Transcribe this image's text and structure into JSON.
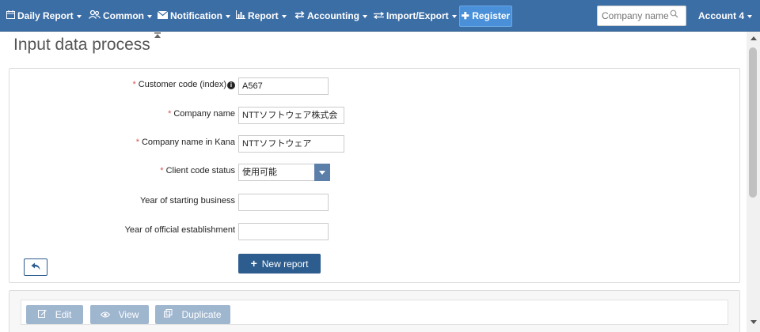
{
  "nav": {
    "daily_report": "Daily Report",
    "common": "Common",
    "notification": "Notification",
    "report": "Report",
    "accounting": "Accounting",
    "import_export": "Import/Export",
    "register": "Register",
    "search_placeholder": "Company name",
    "account": "Account 4"
  },
  "page": {
    "title": "Input data process"
  },
  "form": {
    "customer_code_label": "Customer code (index)",
    "customer_code_value": "A567",
    "company_name_label": "Company name",
    "company_name_value": "NTTソフトウェア株式会",
    "company_kana_label": "Company name in Kana",
    "company_kana_value": "NTTソフトウェア",
    "client_status_label": "Client code status",
    "client_status_value": "使用可能",
    "year_start_label": "Year of starting business",
    "year_start_value": "",
    "year_establish_label": "Year of official establishment",
    "year_establish_value": "",
    "required_mark": "*",
    "info_glyph": "i",
    "new_report_label": "New report"
  },
  "actions": {
    "edit": "Edit",
    "view": "View",
    "duplicate": "Duplicate"
  },
  "icons": {
    "daily_report": "calendar-icon",
    "common": "users-icon",
    "notification": "envelope-icon",
    "report": "bar-chart-icon",
    "accounting": "exchange-icon",
    "import_export": "arrows-icon",
    "register": "plus-icon",
    "search": "search-icon",
    "pin": "pin-icon",
    "back": "reply-icon",
    "edit": "edit-icon",
    "view": "eye-icon",
    "duplicate": "copy-icon"
  },
  "colors": {
    "navbar": "#3c6ea6",
    "primary_button": "#2d5d8f",
    "register_button": "#4a90d9",
    "disabled_button": "#9fb6cf",
    "required": "#d9534f"
  }
}
